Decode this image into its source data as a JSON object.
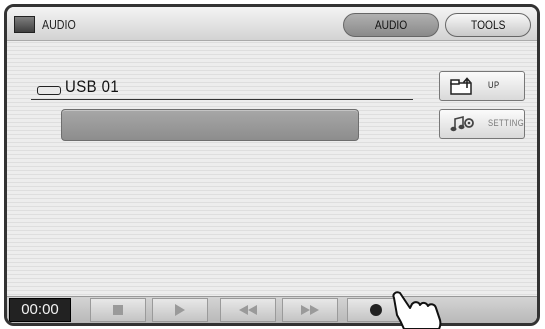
{
  "header": {
    "title": "AUDIO",
    "icon": "audio-screen-icon",
    "tabs": [
      {
        "label": "AUDIO",
        "active": true
      },
      {
        "label": "TOOLS",
        "active": false
      }
    ]
  },
  "device": {
    "icon": "usb-drive-icon",
    "label": "USB 01"
  },
  "side_buttons": {
    "up_label": "UP",
    "setting_label": "SETTING",
    "setting_enabled": false
  },
  "transport": {
    "time": "00:00",
    "buttons": [
      "stop-icon",
      "play-icon",
      "rewind-icon",
      "fast-forward-icon",
      "record-icon"
    ]
  },
  "colors": {
    "active_tab": "#9a9a9a",
    "time_display_bg": "#222222"
  }
}
